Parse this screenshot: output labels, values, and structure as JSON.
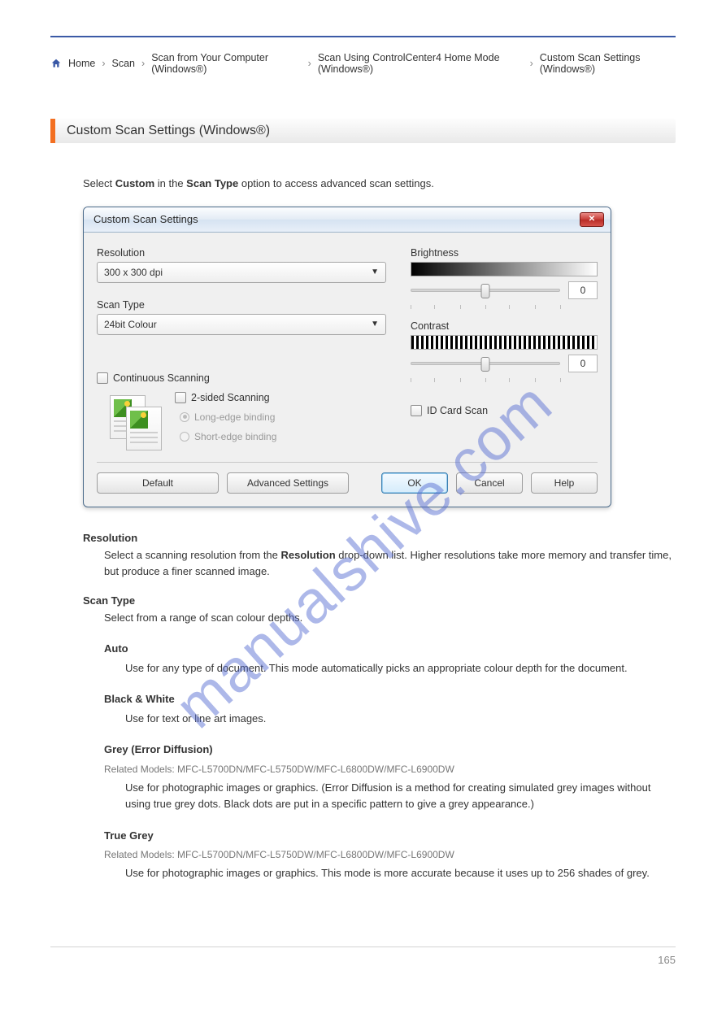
{
  "breadcrumb": {
    "items": [
      "Home",
      "Scan",
      "Scan from Your Computer (Windows®)",
      "Scan Using ControlCenter4 Home Mode (Windows®)",
      "Custom Scan Settings (Windows®)"
    ]
  },
  "section": {
    "title": "Custom Scan Settings (Windows®)"
  },
  "lead": {
    "prefix": "Select ",
    "bold": "Custom",
    "mid": " in the ",
    "bold2": "Scan Type",
    "suffix": " option to access advanced scan settings."
  },
  "dialog": {
    "title": "Custom Scan Settings",
    "resolution_label": "Resolution",
    "resolution_value": "300 x 300 dpi",
    "scantype_label": "Scan Type",
    "scantype_value": "24bit Colour",
    "continuous_label": "Continuous Scanning",
    "twoSided_label": "2-sided Scanning",
    "longedge_label": "Long-edge binding",
    "shortedge_label": "Short-edge binding",
    "brightness_label": "Brightness",
    "brightness_value": "0",
    "contrast_label": "Contrast",
    "contrast_value": "0",
    "idcard_label": "ID Card Scan",
    "buttons": {
      "default": "Default",
      "advanced": "Advanced Settings",
      "ok": "OK",
      "cancel": "Cancel",
      "help": "Help"
    }
  },
  "fields": {
    "resolution": {
      "name": "Resolution",
      "desc_a": "Select a scanning resolution from the ",
      "desc_bold": "Resolution",
      "desc_b": " drop-down list. Higher resolutions take more memory and transfer time, but produce a finer scanned image."
    },
    "scantype": {
      "name": "Scan Type",
      "desc": "Select from a range of scan colour depths.",
      "auto": {
        "name": "Auto",
        "desc": "Use for any type of document. This mode automatically picks an appropriate colour depth for the document."
      },
      "bw": {
        "name": "Black & White",
        "desc": "Use for text or line art images."
      },
      "grey": {
        "name": "Grey (Error Diffusion)",
        "desc": "Use for photographic images or graphics. (Error Diffusion is a method for creating simulated grey images without using true grey dots. Black dots are put in a specific pattern to give a grey appearance.)"
      },
      "truegrey": {
        "name": "True Grey",
        "desc": "Use for photographic images or graphics. This mode is more accurate because it uses up to 256 shades of grey."
      }
    },
    "ref_models": "Related Models: MFC-L5700DN/MFC-L5750DW/MFC-L6800DW/MFC-L6900DW"
  },
  "watermark": "manualshive.com",
  "page_number": "165"
}
